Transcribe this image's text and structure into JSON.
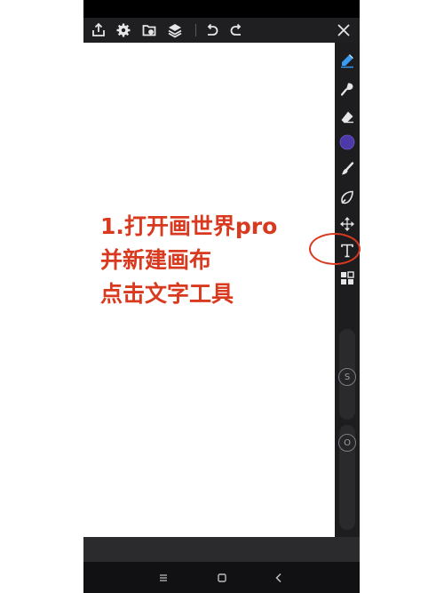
{
  "app": {
    "name": "画世界pro"
  },
  "top_toolbar": {
    "icons": [
      "share-icon",
      "settings-icon",
      "gallery-icon",
      "layers-icon",
      "undo-icon",
      "redo-icon",
      "close-icon"
    ]
  },
  "side_toolbar": {
    "tools": [
      "pen-brush-icon",
      "smudge-icon",
      "eraser-icon",
      "color-icon",
      "brush-set-icon",
      "lasso-icon",
      "move-icon",
      "text-tool-icon",
      "more-tools-icon"
    ],
    "active_color": "#4d3aa8",
    "size_slider_label": "S",
    "opacity_slider_label": "O"
  },
  "annotation": {
    "line1": "1.打开画世界pro",
    "line2": "并新建画布",
    "line3": "点击文字工具",
    "color": "#d8391f"
  },
  "highlight_target": "text-tool-icon",
  "nav_bar": {
    "icons": [
      "menu-icon",
      "home-icon",
      "back-icon"
    ]
  }
}
